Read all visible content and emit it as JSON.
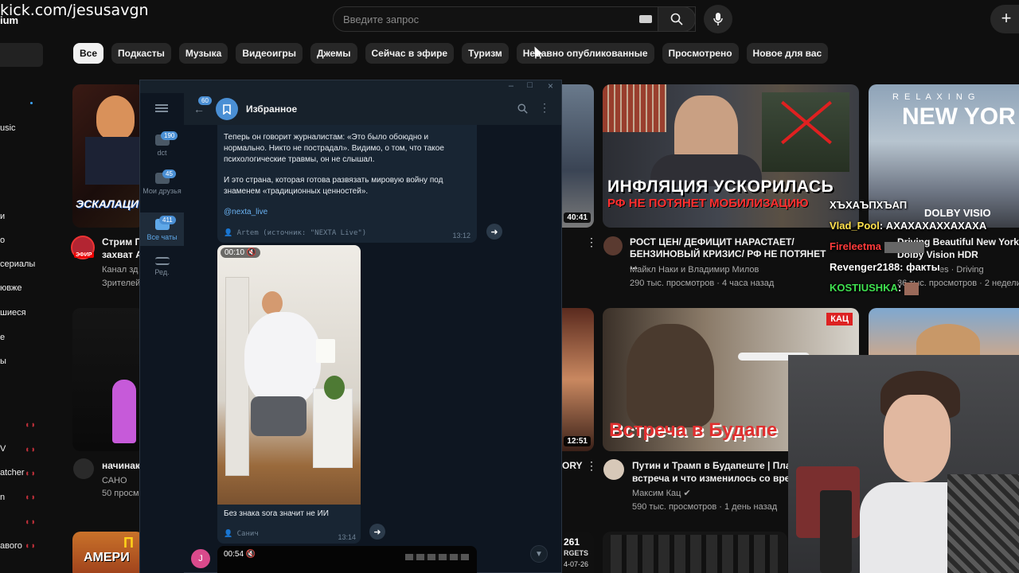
{
  "stream_overlay": {
    "url": "kick.com/jesusavgn",
    "logo_fragment": "ium"
  },
  "search": {
    "placeholder": "Введите запрос"
  },
  "chips": [
    "Все",
    "Подкасты",
    "Музыка",
    "Видеоигры",
    "Джемы",
    "Сейчас в эфире",
    "Туризм",
    "Недавно опубликованные",
    "Просмотрено",
    "Новое для вас"
  ],
  "sidebar": {
    "items": [
      "usic",
      "и",
      "о",
      "сериалы",
      "ювже",
      "шиеся",
      "е",
      "ы",
      "V",
      "atcher",
      "n",
      "авого"
    ]
  },
  "videos": {
    "left_top": {
      "thumb_text": "ЭСКАЛАЦИ",
      "title": "Стрим П",
      "title2": "захват А",
      "channel": "Канал зд",
      "meta": "Зрителей",
      "live_badge": "ЭФИР"
    },
    "left_bottom": {
      "title": "начинак",
      "channel": "САНО",
      "meta": "50 просм"
    },
    "left_third": {
      "thumb_text": "П",
      "thumb_text2": "АМЕРИ"
    },
    "mid_top": {
      "duration": "40:41"
    },
    "mid_bottom": {
      "duration": "12:51",
      "title_frag": "ORY"
    },
    "mid_third": {
      "text1": "261",
      "text2": "RGETS",
      "text3": "4-07-26"
    },
    "center_top": {
      "thumb_line1": "ИНФЛЯЦИЯ УСКОРИЛАСЬ",
      "thumb_line2": "РФ НЕ ПОТЯНЕТ МОБИЛИЗАЦИЮ",
      "title": "РОСТ ЦЕН/ ДЕФИЦИТ НАРАСТАЕТ/ БЕНЗИНОВЫЙ КРИЗИС/ РФ НЕ ПОТЯНЕТ ...",
      "channel": "Майкл Наки и Владимир Милов",
      "meta": "290 тыс. просмотров · 4 часа назад"
    },
    "center_bottom": {
      "thumb_badge": "КАЦ",
      "thumb_text": "Встреча в Будапе",
      "title": "Путин и Трамп в Будапеште | План",
      "title2": "встреча и что изменилось со врем",
      "channel": "Максим Кац",
      "meta": "590 тыс. просмотров · 1 день назад"
    },
    "right_top": {
      "thumb_line1": "R E L A X I N G",
      "thumb_line2": "NEW YOR",
      "thumb_badge": "DOLBY VISIO",
      "title": "Driving Beautiful New York Ci",
      "sub": "Dolby Vision HDR",
      "channel": "es · Driving",
      "meta": "36 тыс. просмотров · 2 недели"
    }
  },
  "telegram": {
    "chat_title": "Избранное",
    "back_badge": "60",
    "folders": [
      {
        "label": "dct",
        "badge": "190"
      },
      {
        "label": "Мои друзья",
        "badge": "45"
      },
      {
        "label": "Все чаты",
        "badge": "411"
      },
      {
        "label": "Ред."
      }
    ],
    "message1": {
      "para1": "Теперь он говорит журналистам: «Это было обоюдно и нормально. Никто не пострадал». Видимо, о том, что такое психологические травмы, он не слышал.",
      "para2": "И это страна, которая готова развязать мировую войну под знаменем «традиционных ценностей».",
      "link": "@nexta_live",
      "signature": "Artem (источник: \"NEXTA Live\")",
      "time": "13:12"
    },
    "message2": {
      "video_time": "00:10",
      "caption": "Без знака sora значит не ИИ",
      "signature": "Санич",
      "time": "13:14"
    },
    "message3": {
      "video_time": "00:54"
    },
    "avatar_letter": "J"
  },
  "chat_overlay": [
    {
      "user": "ХЪХАЪПХЪАП",
      "text": "",
      "color": "#ffffff"
    },
    {
      "user": "Vlad_Pool",
      "text": ": АХАХАХАХХАХАХА",
      "color": "#ffe14d"
    },
    {
      "user": "Fireleetma",
      "text": "",
      "color": "#ff3b3b"
    },
    {
      "user": "Revenger2188",
      "text": ": факты",
      "color": "#ffffff"
    },
    {
      "user": "KOSTIUSHKA",
      "text": ":",
      "color": "#3fe04f"
    }
  ],
  "colors": {
    "telegram_accent": "#5fa8e8",
    "youtube_bg": "#0f0f0f",
    "live_red": "#c0303a"
  }
}
